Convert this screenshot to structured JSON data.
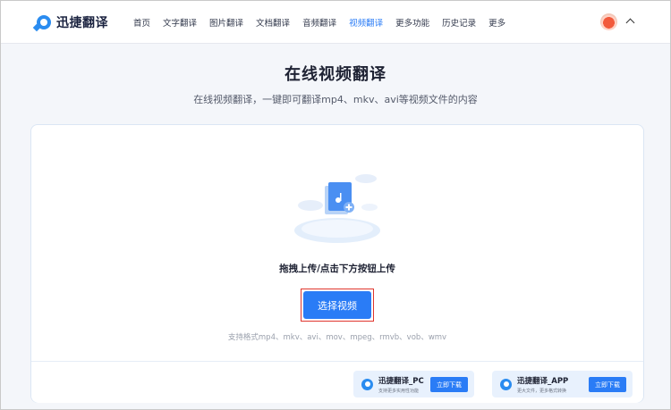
{
  "header": {
    "logo_text": "迅捷翻译",
    "nav": [
      {
        "label": "首页",
        "active": false
      },
      {
        "label": "文字翻译",
        "active": false
      },
      {
        "label": "图片翻译",
        "active": false
      },
      {
        "label": "文档翻译",
        "active": false
      },
      {
        "label": "音频翻译",
        "active": false
      },
      {
        "label": "视频翻译",
        "active": true
      },
      {
        "label": "更多功能",
        "active": false
      },
      {
        "label": "历史记录",
        "active": false
      },
      {
        "label": "更多",
        "active": false
      }
    ]
  },
  "hero": {
    "title": "在线视频翻译",
    "subtitle": "在线视频翻译，一键即可翻译mp4、mkv、avi等视频文件的内容"
  },
  "upload": {
    "drag_text": "拖拽上传/点击下方按钮上传",
    "select_button": "选择视频",
    "formats": "支持格式mp4、mkv、avi、mov、mpeg、rmvb、vob、wmv"
  },
  "downloads": [
    {
      "name": "迅捷翻译_PC",
      "desc": "支持更多实用性功能",
      "button": "立即下载"
    },
    {
      "name": "迅捷翻译_APP",
      "desc": "更大文件，更多格式转换",
      "button": "立即下载"
    }
  ],
  "colors": {
    "accent": "#2a7cf6",
    "highlight": "#e0362e",
    "background": "#f4f6fa"
  }
}
